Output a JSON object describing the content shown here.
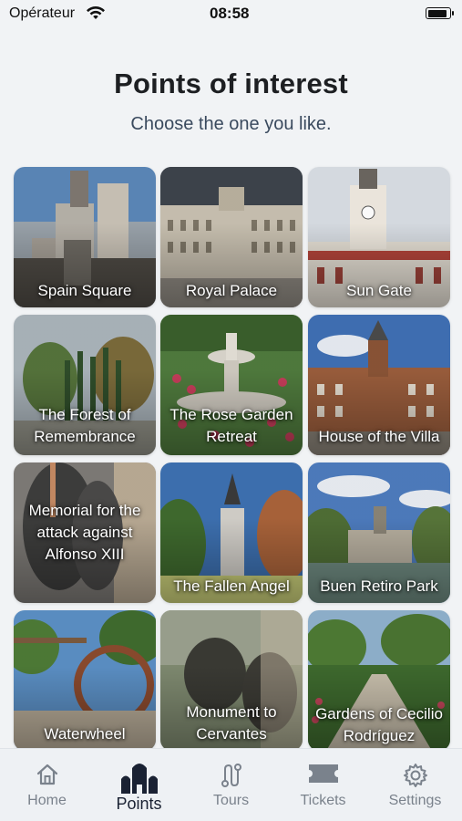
{
  "status": {
    "carrier": "Opérateur",
    "time": "08:58"
  },
  "header": {
    "title": "Points of interest",
    "subtitle": "Choose the one you like."
  },
  "places": [
    {
      "label": "Spain Square"
    },
    {
      "label": "Royal Palace"
    },
    {
      "label": "Sun Gate"
    },
    {
      "label": "The Forest of Remembrance"
    },
    {
      "label": "The Rose Garden Retreat"
    },
    {
      "label": "House of the Villa"
    },
    {
      "label": "Memorial for the attack against Alfonso XIII"
    },
    {
      "label": "The Fallen Angel"
    },
    {
      "label": "Buen Retiro Park"
    },
    {
      "label": "Waterwheel"
    },
    {
      "label": "Monument to Cervantes"
    },
    {
      "label": "Gardens of Cecilio Rodríguez"
    }
  ],
  "tabs": [
    {
      "label": "Home",
      "icon": "home-icon"
    },
    {
      "label": "Points",
      "icon": "cathedral-icon",
      "active": true
    },
    {
      "label": "Tours",
      "icon": "route-icon"
    },
    {
      "label": "Tickets",
      "icon": "ticket-icon"
    },
    {
      "label": "Settings",
      "icon": "gear-icon"
    }
  ],
  "colors": {
    "background": "#f1f3f5",
    "active_tab": "#1a2233",
    "inactive_tab": "#7a828c",
    "subtitle": "#3a4a5e"
  }
}
